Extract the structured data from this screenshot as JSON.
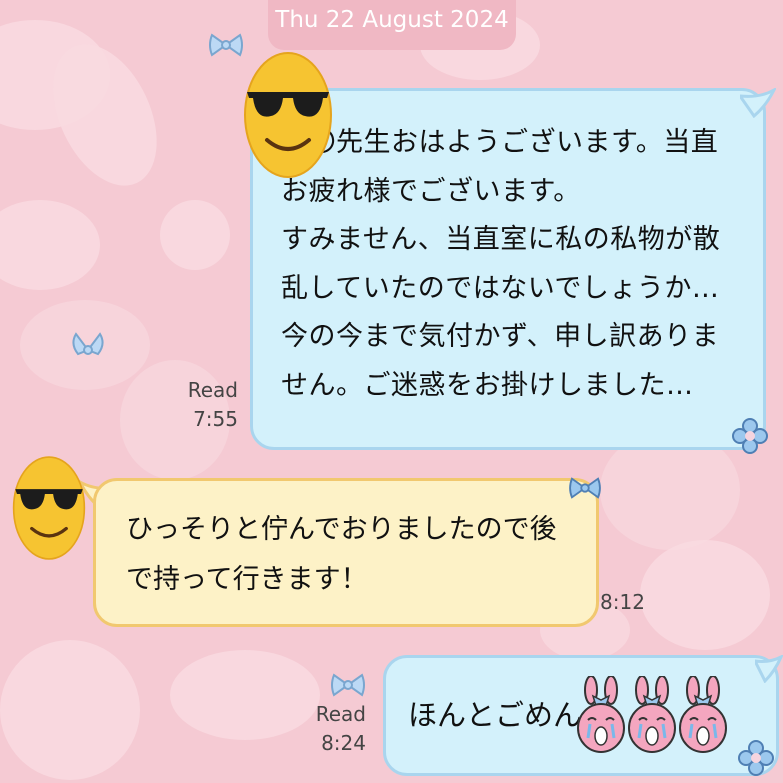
{
  "date_header": "Thu 22 August 2024",
  "messages": [
    {
      "side": "outgoing",
      "text": "〇〇先生おはようございます。当直\nお疲れ様でございます。\nすみません、当直室に私の私物が散\n乱していたのではないでしょうか…\n今の今まで気付かず、申し訳ありま\nせん。ご迷惑をお掛けしました…",
      "read_label": "Read",
      "time": "7:55"
    },
    {
      "side": "incoming",
      "text": "ひっそりと佇んでおりましたので後\nで持って行きます！",
      "time": "8:12"
    },
    {
      "side": "outgoing",
      "text": "ほんとごめん",
      "read_label": "Read",
      "time": "8:24"
    }
  ],
  "icons": {
    "avatar": "sunglasses-emoji-icon",
    "sticker": "crying-bunny-icon",
    "bow": "blue-bow-icon",
    "flower": "blue-flower-icon"
  },
  "colors": {
    "background": "#f5cad3",
    "outgoing_bubble": "#d3f1fb",
    "incoming_bubble": "#fdf2c7",
    "date_pill": "#f0b8c4"
  }
}
